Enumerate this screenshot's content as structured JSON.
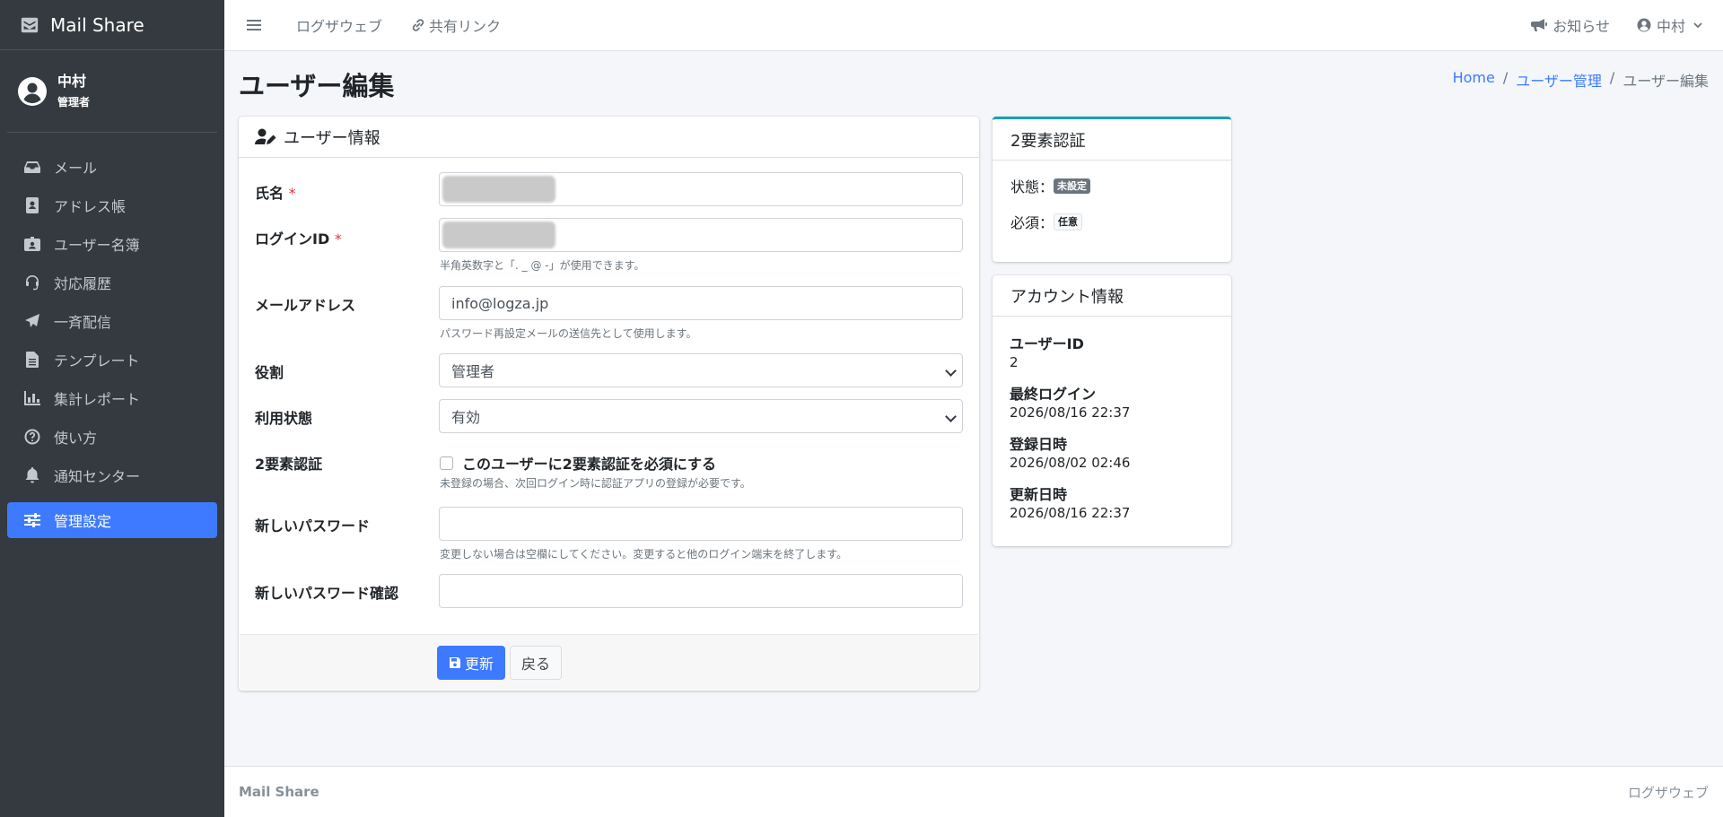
{
  "brand": {
    "name": "Mail Share"
  },
  "user_panel": {
    "name": "中村",
    "role": "管理者"
  },
  "sidebar": {
    "items": [
      {
        "label": "メール",
        "icon": "inbox-icon"
      },
      {
        "label": "アドレス帳",
        "icon": "address-book-icon"
      },
      {
        "label": "ユーザー名簿",
        "icon": "id-badge-icon"
      },
      {
        "label": "対応履歴",
        "icon": "headset-icon"
      },
      {
        "label": "一斉配信",
        "icon": "paper-plane-icon"
      },
      {
        "label": "テンプレート",
        "icon": "file-icon"
      },
      {
        "label": "集計レポート",
        "icon": "bar-chart-icon"
      },
      {
        "label": "使い方",
        "icon": "question-circle-icon"
      },
      {
        "label": "通知センター",
        "icon": "bell-icon"
      },
      {
        "label": "管理設定",
        "icon": "sliders-icon",
        "active": true
      }
    ]
  },
  "topbar": {
    "link1": "ログザウェブ",
    "link2": "共有リンク",
    "notice": "お知らせ",
    "user": "中村"
  },
  "page": {
    "title": "ユーザー編集",
    "breadcrumb": [
      "Home",
      "ユーザー管理",
      "ユーザー編集"
    ]
  },
  "form": {
    "header": "ユーザー情報",
    "name_label": "氏名",
    "login_label": "ログインID",
    "login_help": "半角英数字と「. _ @ -」が使用できます。",
    "email_label": "メールアドレス",
    "email_value": "info@logza.jp",
    "email_help": "パスワード再設定メールの送信先として使用します。",
    "role_label": "役割",
    "role_value": "管理者",
    "status_label": "利用状態",
    "status_value": "有効",
    "tfa_label": "2要素認証",
    "tfa_check": "このユーザーに2要素認証を必須にする",
    "tfa_help": "未登録の場合、次回ログイン時に認証アプリの登録が必要です。",
    "pw_label": "新しいパスワード",
    "pw_help": "変更しない場合は空欄にしてください。変更すると他のログイン端末を終了します。",
    "pw_confirm_label": "新しいパスワード確認",
    "required_mark": "*",
    "update_button": "更新",
    "back_button": "戻る"
  },
  "tfa_card": {
    "header": "2要素認証",
    "status_label": "状態：",
    "status_badge": "未設定",
    "required_label": "必須：",
    "required_badge": "任意"
  },
  "account_card": {
    "header": "アカウント情報",
    "user_id_label": "ユーザーID",
    "user_id": "2",
    "last_login_label": "最終ログイン",
    "last_login": "2026/08/16 22:37",
    "created_label": "登録日時",
    "created": "2026/08/02 02:46",
    "updated_label": "更新日時",
    "updated": "2026/08/16 22:37"
  },
  "footer": {
    "left": "Mail Share",
    "right": "ログザウェブ"
  },
  "colors": {
    "accent": "#3d7aff",
    "sidebar_bg": "#343a40",
    "info_border": "#17a2b8"
  }
}
